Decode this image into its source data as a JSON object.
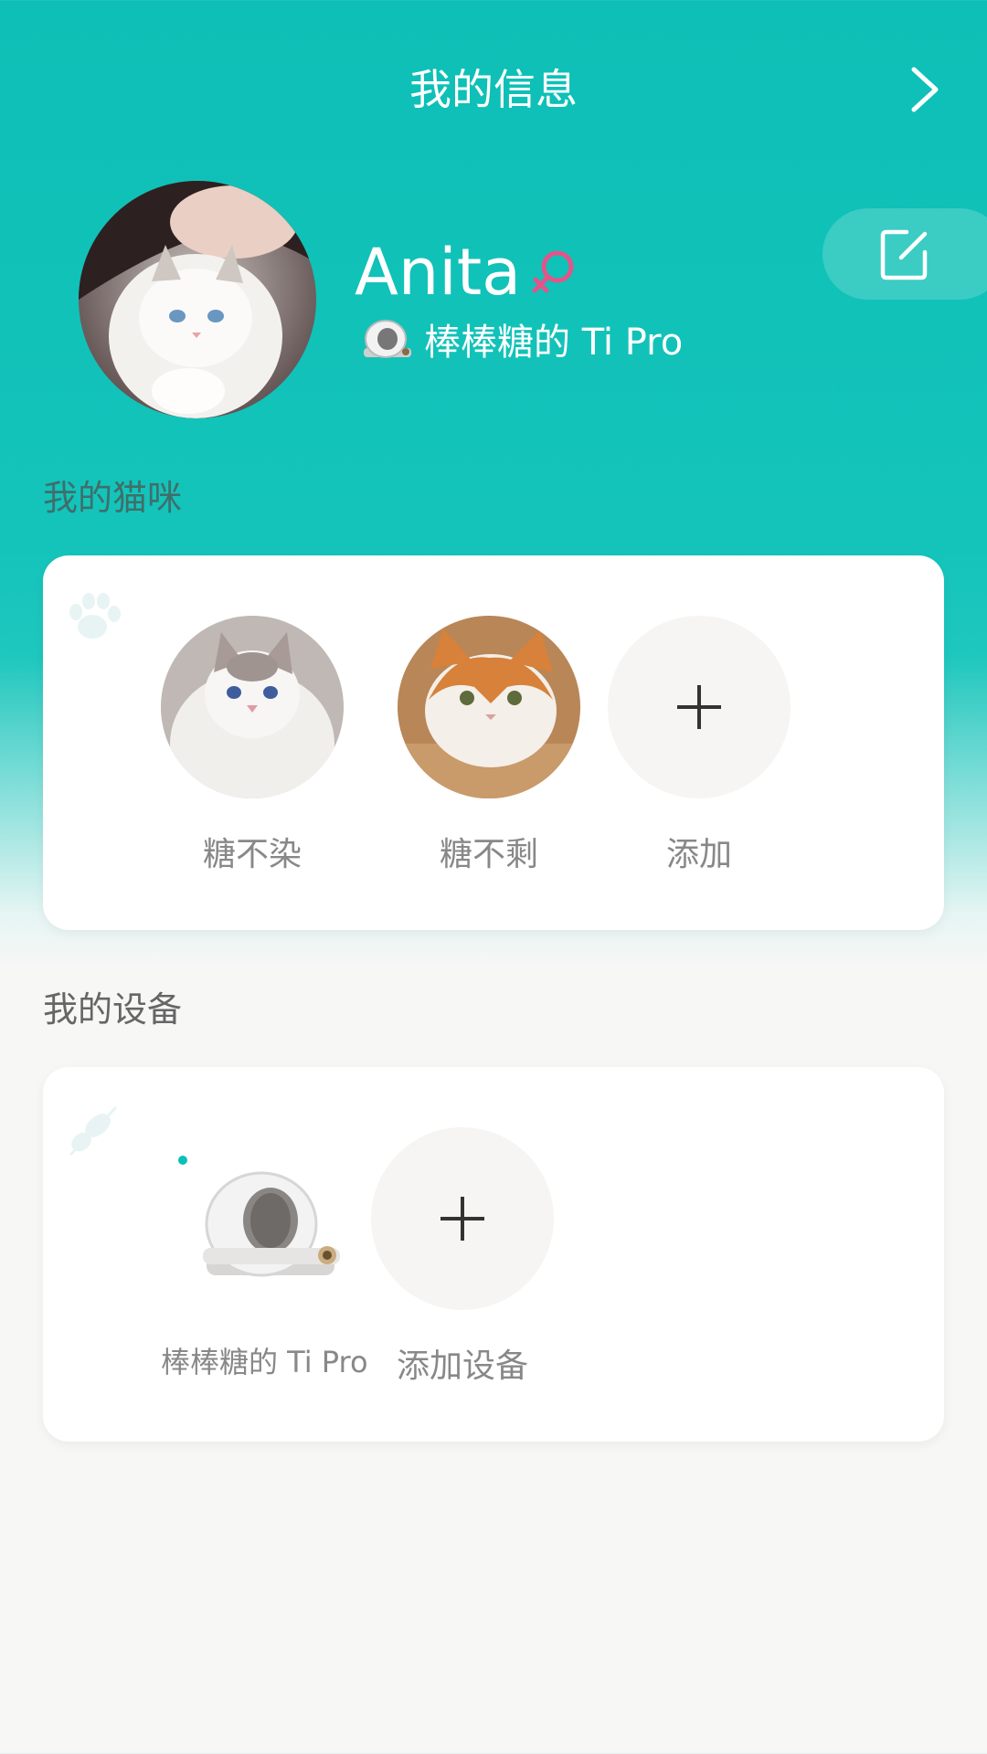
{
  "header": {
    "title": "我的信息"
  },
  "profile": {
    "name": "Anita",
    "device_line": "棒棒糖的 Ti Pro"
  },
  "sections": {
    "cats_title": "我的猫咪",
    "devices_title": "我的设备"
  },
  "cats": [
    {
      "name": "糖不染"
    },
    {
      "name": "糖不剩"
    }
  ],
  "cats_add_label": "添加",
  "devices": [
    {
      "name": "棒棒糖的 Ti Pro",
      "online": true
    }
  ],
  "devices_add_label": "添加设备",
  "colors": {
    "accent": "#0dbfb6",
    "gender_female": "#e2558a",
    "background": "#f7f7f6"
  },
  "icons": {
    "back": "chevron-right-icon",
    "edit": "edit-icon",
    "gender": "female-icon",
    "add": "plus-icon",
    "cats_deco": "paw-icon",
    "devices_deco": "leaf-icon"
  }
}
